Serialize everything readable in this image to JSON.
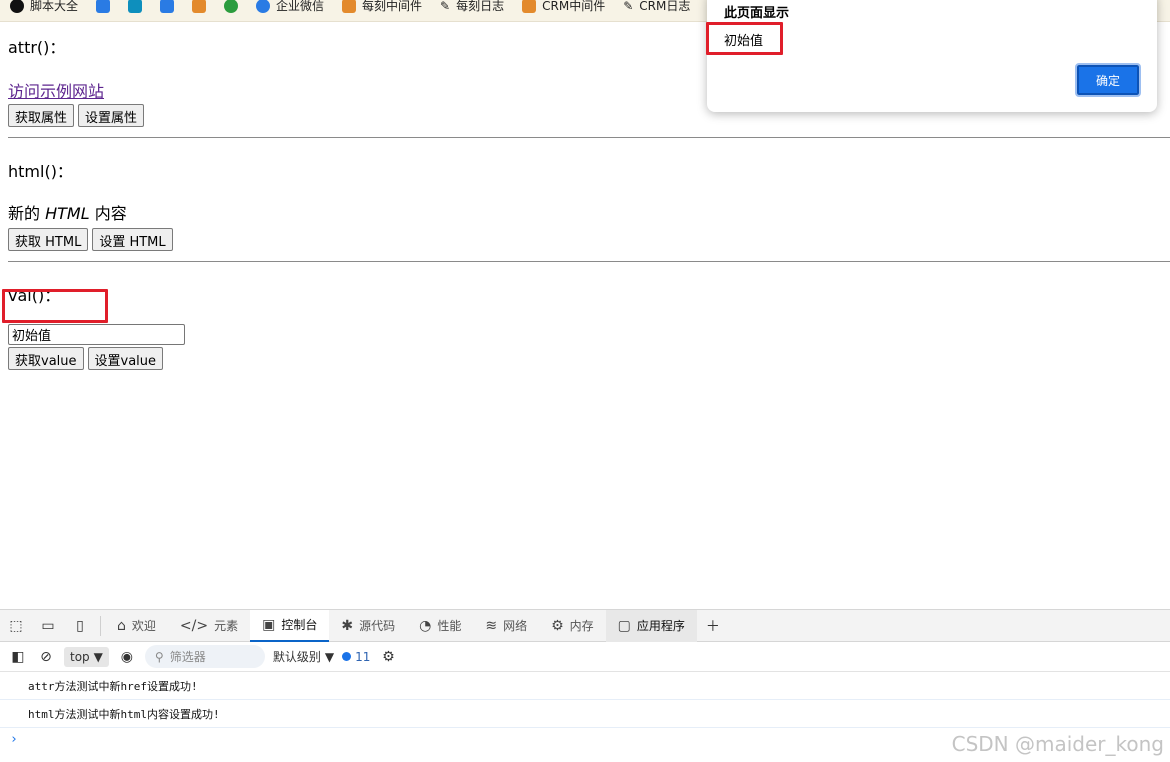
{
  "bookmarks": [
    {
      "label": "脚本大全",
      "icon": "black-circle-icon"
    },
    {
      "label": "",
      "icon": "app-icon"
    },
    {
      "label": "",
      "icon": "app-icon"
    },
    {
      "label": "",
      "icon": "app-icon"
    },
    {
      "label": "",
      "icon": "app-icon"
    },
    {
      "label": "",
      "icon": "gear-green-icon"
    },
    {
      "label": "企业微信",
      "icon": "wecom-icon"
    },
    {
      "label": "每刻中间件",
      "icon": "maycur-icon"
    },
    {
      "label": "每刻日志",
      "icon": "pen-icon"
    },
    {
      "label": "CRM中间件",
      "icon": "maycur-icon"
    },
    {
      "label": "CRM日志",
      "icon": "pen-icon"
    }
  ],
  "page": {
    "attr_title": "attr()：",
    "link_text": "访问示例网站",
    "btn_get_attr": "获取属性",
    "btn_set_attr": "设置属性",
    "html_title": "html()：",
    "html_prefix": "新的 ",
    "html_em": "HTML",
    "html_suffix": " 内容",
    "btn_get_html": "获取 HTML",
    "btn_set_html": "设置 HTML",
    "val_title": "val()：",
    "input_value": "初始值",
    "btn_get_value": "获取value",
    "btn_set_value": "设置value"
  },
  "alert": {
    "title": "此页面显示",
    "message": "初始值",
    "ok": "确定"
  },
  "devtools": {
    "tabs": [
      {
        "label": "欢迎",
        "icon": "home-icon",
        "active": false
      },
      {
        "label": "元素",
        "icon": "code-icon",
        "active": false
      },
      {
        "label": "控制台",
        "icon": "console-icon",
        "active": true
      },
      {
        "label": "源代码",
        "icon": "bug-icon",
        "active": false
      },
      {
        "label": "性能",
        "icon": "gauge-icon",
        "active": false
      },
      {
        "label": "网络",
        "icon": "wifi-icon",
        "active": false
      },
      {
        "label": "内存",
        "icon": "chip-icon",
        "active": false
      },
      {
        "label": "应用程序",
        "icon": "app-window-icon",
        "active": false
      }
    ],
    "toolbar": {
      "context": "top",
      "filter_placeholder": "筛选器",
      "level": "默认级别",
      "message_count": "11"
    },
    "logs": [
      "attr方法测试中新href设置成功!",
      "html方法测试中新html内容设置成功!"
    ],
    "prompt": "›"
  },
  "watermark": "CSDN @maider_kong"
}
